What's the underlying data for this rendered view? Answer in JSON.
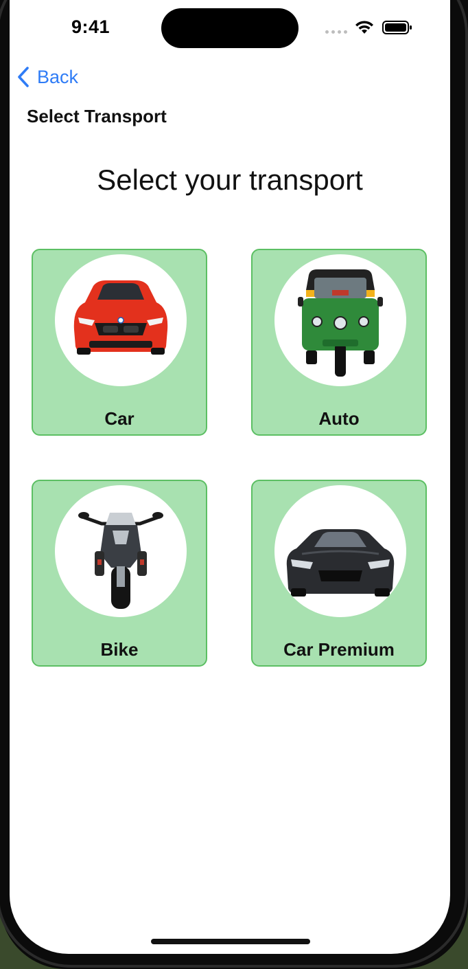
{
  "status_bar": {
    "time": "9:41"
  },
  "nav": {
    "back_label": "Back",
    "title": "Select Transport"
  },
  "heading": "Select your transport",
  "options": [
    {
      "label": "Car",
      "image": "red-car-image"
    },
    {
      "label": "Auto",
      "image": "auto-rickshaw-image"
    },
    {
      "label": "Bike",
      "image": "motorcycle-image"
    },
    {
      "label": "Car Premium",
      "image": "black-sports-car-image"
    }
  ],
  "colors": {
    "card_fill": "#a8e1b0",
    "card_border": "#5cbf63",
    "accent_blue": "#2f7cf6"
  }
}
